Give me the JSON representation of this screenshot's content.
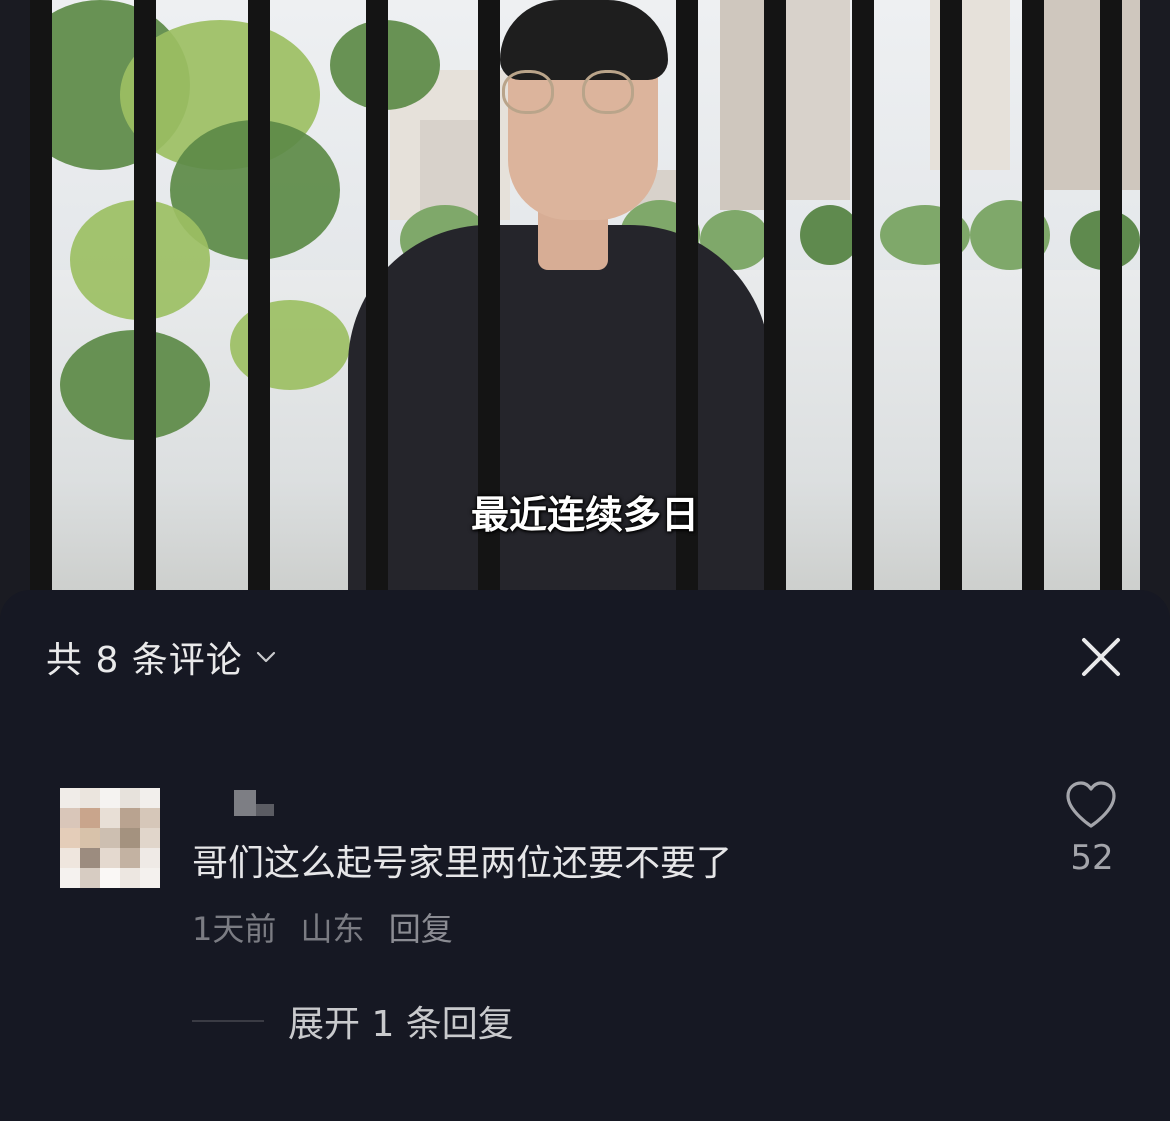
{
  "video": {
    "caption": "最近连续多日"
  },
  "comments_panel": {
    "title": "共 8 条评论",
    "chevron_icon": "chevron-down-icon",
    "close_icon": "close-icon",
    "comment": {
      "text": "哥们这么起号家里两位还要不要了",
      "time": "1天前",
      "location": "山东",
      "reply_label": "回复",
      "like_icon": "heart-outline-icon",
      "like_count": "52"
    },
    "expand_replies": "展开 1 条回复"
  },
  "colors": {
    "sheet_bg": "#161823",
    "text_primary": "#e6e6e8",
    "text_secondary": "#7b7c83"
  }
}
